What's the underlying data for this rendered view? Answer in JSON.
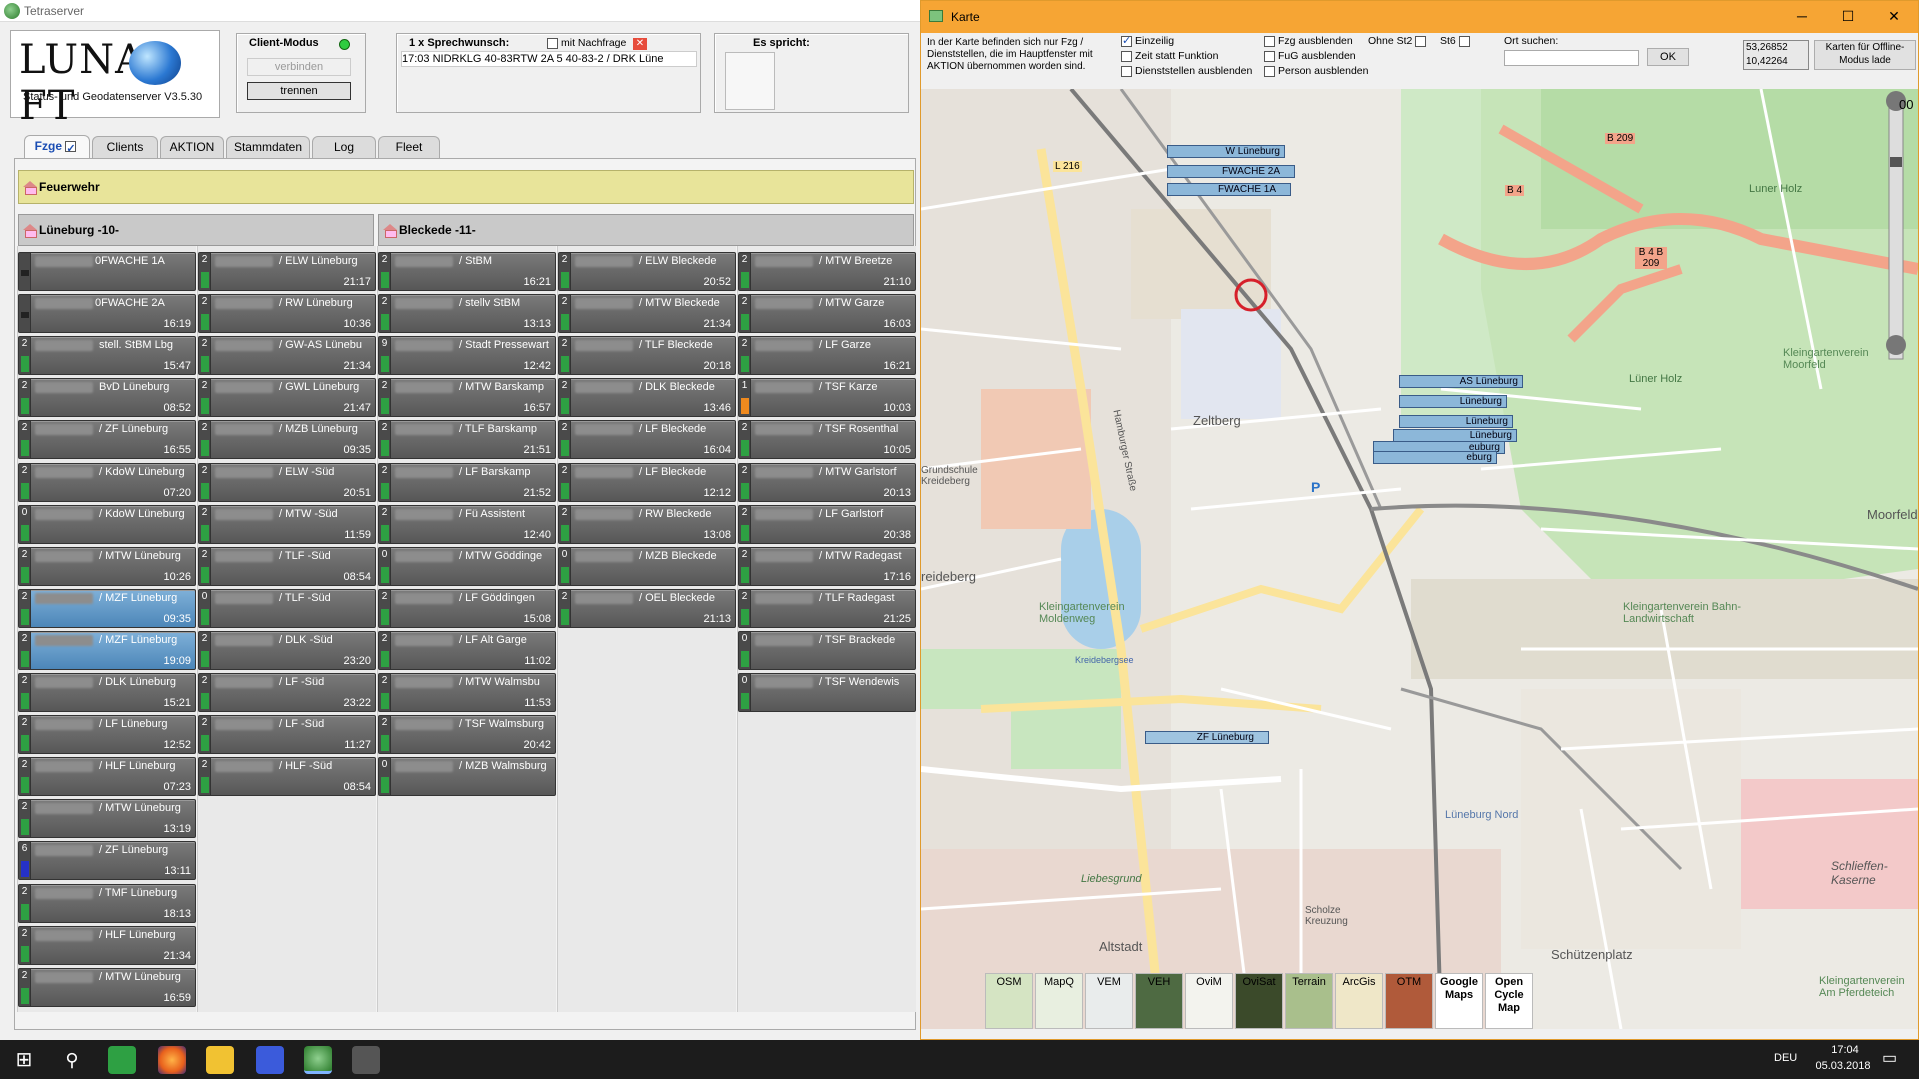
{
  "left_window": {
    "title": "Tetraserver",
    "logo": {
      "brand": "LUNAS FT",
      "subtitle": "Status- und Geodatenserver  V3.5.30"
    },
    "client_mode": {
      "title": "Client-Modus",
      "connect_label": "verbinden",
      "disconnect_label": "trennen",
      "status_color": "#2ecc40"
    },
    "speech_request": {
      "title": "1 x  Sprechwunsch:",
      "followup_label": "mit Nachfrage",
      "row": "17:03  NIDRKLG 40-83RTW       2A     5     40-83-2 / DRK Lüne"
    },
    "speaking": {
      "title": "Es spricht:"
    },
    "tabs": [
      {
        "label": "Fzge"
      },
      {
        "label": "Clients"
      },
      {
        "label": "AKTION"
      },
      {
        "label": "Stammdaten"
      },
      {
        "label": "Log"
      },
      {
        "label": "Fleet"
      }
    ],
    "section_title": "Feuerwehr",
    "groups": [
      {
        "title": "Lüneburg  -10-"
      },
      {
        "title": "Bleckede  -11-"
      }
    ],
    "vehicles": [
      [
        {
          "status": "",
          "name": "0FWACHE   1A",
          "time": "",
          "bar": "dark",
          "large": true
        },
        {
          "status": "",
          "name": "0FWACHE   2A",
          "time": "16:19",
          "bar": "dark",
          "large": true
        },
        {
          "status": "2",
          "name": "stell. StBM Lbg",
          "time": "15:47",
          "bar": "green"
        },
        {
          "status": "2",
          "name": "BvD Lüneburg",
          "time": "08:52",
          "bar": "green"
        },
        {
          "status": "2",
          "name": "/ ZF Lüneburg",
          "time": "16:55",
          "bar": "green"
        },
        {
          "status": "2",
          "name": "/ KdoW Lüneburg",
          "time": "07:20",
          "bar": "green"
        },
        {
          "status": "0",
          "name": "/ KdoW Lüneburg",
          "time": "",
          "bar": "green"
        },
        {
          "status": "2",
          "name": "/ MTW  Lüneburg",
          "time": "10:26",
          "bar": "green"
        },
        {
          "status": "2",
          "name": "/ MZF Lüneburg",
          "time": "09:35",
          "bar": "green",
          "blue": true
        },
        {
          "status": "2",
          "name": "/ MZF Lüneburg",
          "time": "19:09",
          "bar": "green",
          "blue": true
        },
        {
          "status": "2",
          "name": "/ DLK Lüneburg",
          "time": "15:21",
          "bar": "green"
        },
        {
          "status": "2",
          "name": "/ LF Lüneburg",
          "time": "12:52",
          "bar": "green"
        },
        {
          "status": "2",
          "name": "/ HLF  Lüneburg",
          "time": "07:23",
          "bar": "green"
        },
        {
          "status": "2",
          "name": "/ MTW Lüneburg",
          "time": "13:19",
          "bar": "green"
        },
        {
          "status": "6",
          "name": "/ ZF  Lüneburg",
          "time": "13:11",
          "bar": "blue"
        },
        {
          "status": "2",
          "name": "/ TMF Lüneburg",
          "time": "18:13",
          "bar": "green"
        },
        {
          "status": "2",
          "name": "/ HLF Lüneburg",
          "time": "21:34",
          "bar": "green"
        },
        {
          "status": "2",
          "name": "/ MTW Lüneburg",
          "time": "16:59",
          "bar": "green"
        }
      ],
      [
        {
          "status": "2",
          "name": "/ ELW Lüneburg",
          "time": "21:17",
          "bar": "green"
        },
        {
          "status": "2",
          "name": "/ RW Lüneburg",
          "time": "10:36",
          "bar": "green"
        },
        {
          "status": "2",
          "name": "/ GW-AS Lünebu",
          "time": "21:34",
          "bar": "green"
        },
        {
          "status": "2",
          "name": "/ GWL Lüneburg",
          "time": "21:47",
          "bar": "green"
        },
        {
          "status": "2",
          "name": "/ MZB Lüneburg",
          "time": "09:35",
          "bar": "green"
        },
        {
          "status": "2",
          "name": "/ ELW -Süd",
          "time": "20:51",
          "bar": "green"
        },
        {
          "status": "2",
          "name": "/ MTW -Süd",
          "time": "11:59",
          "bar": "green"
        },
        {
          "status": "2",
          "name": "/ TLF -Süd",
          "time": "08:54",
          "bar": "green"
        },
        {
          "status": "0",
          "name": "/ TLF -Süd",
          "time": "",
          "bar": "green"
        },
        {
          "status": "2",
          "name": "/ DLK -Süd",
          "time": "23:20",
          "bar": "green"
        },
        {
          "status": "2",
          "name": "/ LF -Süd",
          "time": "23:22",
          "bar": "green"
        },
        {
          "status": "2",
          "name": "/ LF -Süd",
          "time": "11:27",
          "bar": "green"
        },
        {
          "status": "2",
          "name": "/ HLF -Süd",
          "time": "08:54",
          "bar": "green"
        }
      ],
      [
        {
          "status": "2",
          "name": "/ StBM",
          "time": "16:21",
          "bar": "green"
        },
        {
          "status": "2",
          "name": "/ stellv StBM",
          "time": "13:13",
          "bar": "green"
        },
        {
          "status": "9",
          "name": "/ Stadt Pressewart",
          "time": "12:42",
          "bar": "green"
        },
        {
          "status": "2",
          "name": "/ MTW Barskamp",
          "time": "16:57",
          "bar": "green"
        },
        {
          "status": "2",
          "name": "/ TLF Barskamp",
          "time": "21:51",
          "bar": "green"
        },
        {
          "status": "2",
          "name": "/ LF Barskamp",
          "time": "21:52",
          "bar": "green"
        },
        {
          "status": "2",
          "name": "/ Fü Assistent",
          "time": "12:40",
          "bar": "green"
        },
        {
          "status": "0",
          "name": "/ MTW Göddinge",
          "time": "",
          "bar": "green"
        },
        {
          "status": "2",
          "name": "/ LF Göddingen",
          "time": "15:08",
          "bar": "green"
        },
        {
          "status": "2",
          "name": "/ LF Alt Garge",
          "time": "11:02",
          "bar": "green"
        },
        {
          "status": "2",
          "name": "/ MTW Walmsbu",
          "time": "11:53",
          "bar": "green"
        },
        {
          "status": "2",
          "name": "/ TSF Walmsburg",
          "time": "20:42",
          "bar": "green"
        },
        {
          "status": "0",
          "name": "/ MZB Walmsburg",
          "time": "",
          "bar": "green"
        }
      ],
      [
        {
          "status": "2",
          "name": "/ ELW Bleckede",
          "time": "20:52",
          "bar": "green"
        },
        {
          "status": "2",
          "name": "/ MTW Bleckede",
          "time": "21:34",
          "bar": "green"
        },
        {
          "status": "2",
          "name": "/ TLF Bleckede",
          "time": "20:18",
          "bar": "green"
        },
        {
          "status": "2",
          "name": "/ DLK Bleckede",
          "time": "13:46",
          "bar": "green"
        },
        {
          "status": "2",
          "name": "/ LF Bleckede",
          "time": "16:04",
          "bar": "green"
        },
        {
          "status": "2",
          "name": "/ LF Bleckede",
          "time": "12:12",
          "bar": "green"
        },
        {
          "status": "2",
          "name": "/ RW Bleckede",
          "time": "13:08",
          "bar": "green"
        },
        {
          "status": "0",
          "name": "/ MZB Bleckede",
          "time": "",
          "bar": "green"
        },
        {
          "status": "2",
          "name": "/ OEL Bleckede",
          "time": "21:13",
          "bar": "green"
        }
      ],
      [
        {
          "status": "2",
          "name": "/ MTW Breetze",
          "time": "21:10",
          "bar": "green"
        },
        {
          "status": "2",
          "name": "/ MTW Garze",
          "time": "16:03",
          "bar": "green"
        },
        {
          "status": "2",
          "name": "/ LF Garze",
          "time": "16:21",
          "bar": "green"
        },
        {
          "status": "1",
          "name": "/ TSF Karze",
          "time": "10:03",
          "bar": "orange"
        },
        {
          "status": "2",
          "name": "/ TSF Rosenthal",
          "time": "10:05",
          "bar": "green"
        },
        {
          "status": "2",
          "name": "/ MTW Garlstorf",
          "time": "20:13",
          "bar": "green"
        },
        {
          "status": "2",
          "name": "/ LF Garlstorf",
          "time": "20:38",
          "bar": "green"
        },
        {
          "status": "2",
          "name": "/ MTW Radegast",
          "time": "17:16",
          "bar": "green"
        },
        {
          "status": "2",
          "name": "/ TLF Radegast",
          "time": "21:25",
          "bar": "green"
        },
        {
          "status": "0",
          "name": "/ TSF Brackede",
          "time": "",
          "bar": "green"
        },
        {
          "status": "0",
          "name": "/ TSF Wendewis",
          "time": "",
          "bar": "green"
        }
      ]
    ]
  },
  "map_window": {
    "title": "Karte",
    "info_text": "In der Karte befinden sich nur Fzg / Dienststellen, die im Hauptfenster mit AKTION übernommen worden sind.",
    "options": {
      "einzelig": "Einzeilig",
      "zeit_statt_funktion": "Zeit statt Funktion",
      "dienststellen_ausblenden": "Dienststellen ausblenden",
      "fzg_ausblenden": "Fzg ausblenden",
      "fug_ausblenden": "FuG ausblenden",
      "person_ausblenden": "Person ausblenden",
      "ohne_st2": "Ohne St2",
      "st6": "St6"
    },
    "search": {
      "label": "Ort suchen:",
      "ok": "OK"
    },
    "coords": {
      "lat": "53,26852",
      "lon": "10,42264"
    },
    "offline_btn": "Karten für Offline-Modus lade",
    "zoom_level": "00",
    "vehicle_tags": [
      "W Lüneburg",
      "FWACHE   2A",
      "FWACHE   1A",
      "AS Lüneburg",
      "Lüneburg",
      "Lüneburg",
      "Lüneburg",
      "euburg",
      "eburg",
      "ZF Lüneburg"
    ],
    "map_labels": {
      "zeltberg": "Zeltberg",
      "altstadt": "Altstadt",
      "lueneburg_nord": "Lüneburg Nord",
      "moorfeld": "Moorfeld",
      "kleingarten_moorfeld": "Kleingartenverein Moorfeld",
      "luner_holz": "Luner Holz",
      "luner_holz2": "Lüner Holz",
      "schuetzenplatz": "Schützenplatz",
      "schlieffen": "Schlieffen-Kaserne",
      "kreideberg": "reideberg",
      "kleingarten_moldenweg": "Kleingartenverein Moldenweg",
      "kleingarten_bahn": "Kleingartenverein Bahn-Landwirtschaft",
      "kleingarten_pferdeteich": "Kleingartenverein Am Pferdeteich",
      "kreidebergsee": "Kreidebergsee",
      "liebesgrund": "Liebesgrund",
      "scholze": "Scholze Kreuzung",
      "grundschule": "Grundschule Kreideberg",
      "hamburger": "Hamburger Straße",
      "b4": "B 4",
      "b209": "B 209",
      "l216": "L 216",
      "b4b209": "B 4 B 209",
      "p": "P"
    },
    "layers": [
      {
        "label": "OSM"
      },
      {
        "label": "MapQ"
      },
      {
        "label": "VEM"
      },
      {
        "label": "VEH"
      },
      {
        "label": "OviM"
      },
      {
        "label": "OviSat"
      },
      {
        "label": "Terrain"
      },
      {
        "label": "ArcGis"
      },
      {
        "label": "OTM"
      },
      {
        "label": "Google Maps"
      },
      {
        "label": "Open Cycle Map"
      }
    ]
  },
  "taskbar": {
    "lang": "DEU",
    "time": "17:04",
    "date": "05.03.2018"
  }
}
